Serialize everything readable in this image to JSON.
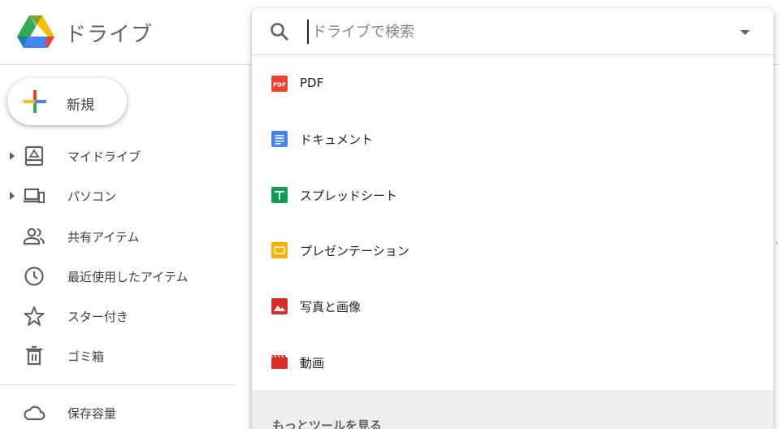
{
  "header": {
    "app_title": "ドライブ",
    "logo_icon": "google-drive-logo"
  },
  "sidebar": {
    "new_button": {
      "label": "新規",
      "icon": "plus-multicolor-icon"
    },
    "items": [
      {
        "label": "マイドライブ",
        "icon": "my-drive-icon",
        "expandable": true
      },
      {
        "label": "パソコン",
        "icon": "computers-icon",
        "expandable": true
      },
      {
        "label": "共有アイテム",
        "icon": "shared-people-icon",
        "expandable": false
      },
      {
        "label": "最近使用したアイテム",
        "icon": "clock-icon",
        "expandable": false
      },
      {
        "label": "スター付き",
        "icon": "star-icon",
        "expandable": false
      },
      {
        "label": "ゴミ箱",
        "icon": "trash-icon",
        "expandable": false
      }
    ],
    "storage": {
      "label": "保存容量",
      "icon": "cloud-icon"
    }
  },
  "search": {
    "placeholder": "ドライブで検索",
    "value": "",
    "search_icon": "search-icon",
    "options_icon": "arrow-drop-down-icon"
  },
  "file_types": [
    {
      "label": "PDF",
      "icon": "pdf-icon",
      "color": "#ea4335"
    },
    {
      "label": "ドキュメント",
      "icon": "docs-icon",
      "color": "#4285f4"
    },
    {
      "label": "スプレッドシート",
      "icon": "sheets-icon",
      "color": "#0f9d58"
    },
    {
      "label": "プレゼンテーション",
      "icon": "slides-icon",
      "color": "#f4b400"
    },
    {
      "label": "写真と画像",
      "icon": "image-icon",
      "color": "#d93025"
    },
    {
      "label": "動画",
      "icon": "video-icon",
      "color": "#d93025"
    }
  ],
  "more_tools": {
    "label": "もっとツールを見る"
  },
  "colors": {
    "blue": "#4285f4",
    "red": "#ea4335",
    "yellow": "#fbbc04",
    "green": "#34a853",
    "icon_gray": "#5f6368",
    "text": "#3c4043",
    "divider": "#dadce0"
  }
}
